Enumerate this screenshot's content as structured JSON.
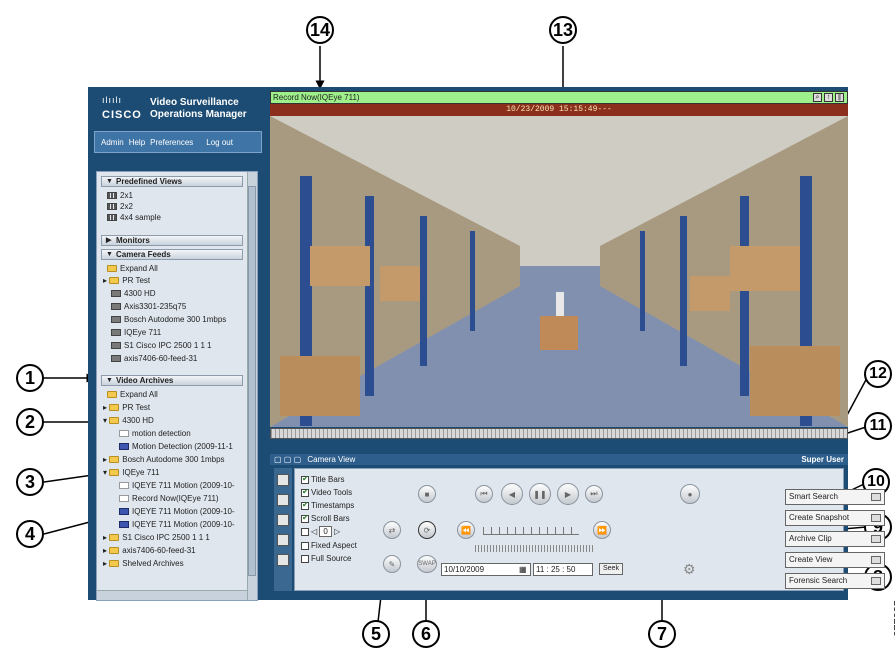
{
  "app": {
    "brand_line1": "Video Surveillance",
    "brand_line2": "Operations Manager",
    "cisco_word": "CISCO",
    "cisco_bars": "ılıılı"
  },
  "topnav": {
    "items": [
      "Admin",
      "Help",
      "Preferences",
      "Log out"
    ]
  },
  "tree": {
    "predefined_views": {
      "label": "Predefined Views",
      "items": [
        "2x1",
        "2x2",
        "4x4 sample"
      ]
    },
    "monitors": {
      "label": "Monitors"
    },
    "camera_feeds": {
      "label": "Camera Feeds",
      "items": [
        "Expand All",
        "PR Test",
        "4300 HD",
        "Axis3301-235q75",
        "Bosch Autodome 300 1mbps",
        "IQEye 711",
        "S1 Cisco IPC 2500 1 1 1",
        "axis7406-60-feed-31"
      ]
    },
    "video_archives": {
      "label": "Video Archives",
      "items": [
        "Expand All",
        "PR Test",
        "4300 HD",
        "motion detection",
        "Motion Detection (2009-11-1",
        "Bosch Autodome 300 1mbps",
        "IQEye 711",
        "IQEYE 711 Motion (2009-10-",
        "Record Now(IQEye 711)",
        "IQEYE 711 Motion (2009-10-",
        "IQEYE 711 Motion (2009-10-",
        "S1 Cisco IPC 2500 1 1 1",
        "axis7406-60-feed-31",
        "Shelved Archives"
      ]
    }
  },
  "video": {
    "title": "Record Now(IQEye 711)",
    "timestamp": "10/23/2009 15:15:49---"
  },
  "camera_view": {
    "title": "Camera View",
    "user": "Super User",
    "options": [
      {
        "label": "Title Bars",
        "checked": true
      },
      {
        "label": "Video Tools",
        "checked": true
      },
      {
        "label": "Timestamps",
        "checked": true
      },
      {
        "label": "Scroll Bars",
        "checked": true
      }
    ],
    "counter_value": "0",
    "fixed_aspect": "Fixed Aspect",
    "full_source": "Full Source",
    "swap_label": "SWAP",
    "date_value": "10/10/2009",
    "time_value": "11 : 25 : 50",
    "seek_label": "Seek",
    "buttons": [
      "Smart Search",
      "Create Snapshot",
      "Archive Clip",
      "Create View",
      "Forensic Search"
    ]
  },
  "callouts": [
    "1",
    "2",
    "3",
    "4",
    "5",
    "6",
    "7",
    "8",
    "9",
    "10",
    "11",
    "12",
    "13",
    "14"
  ],
  "figure_id": "277035"
}
